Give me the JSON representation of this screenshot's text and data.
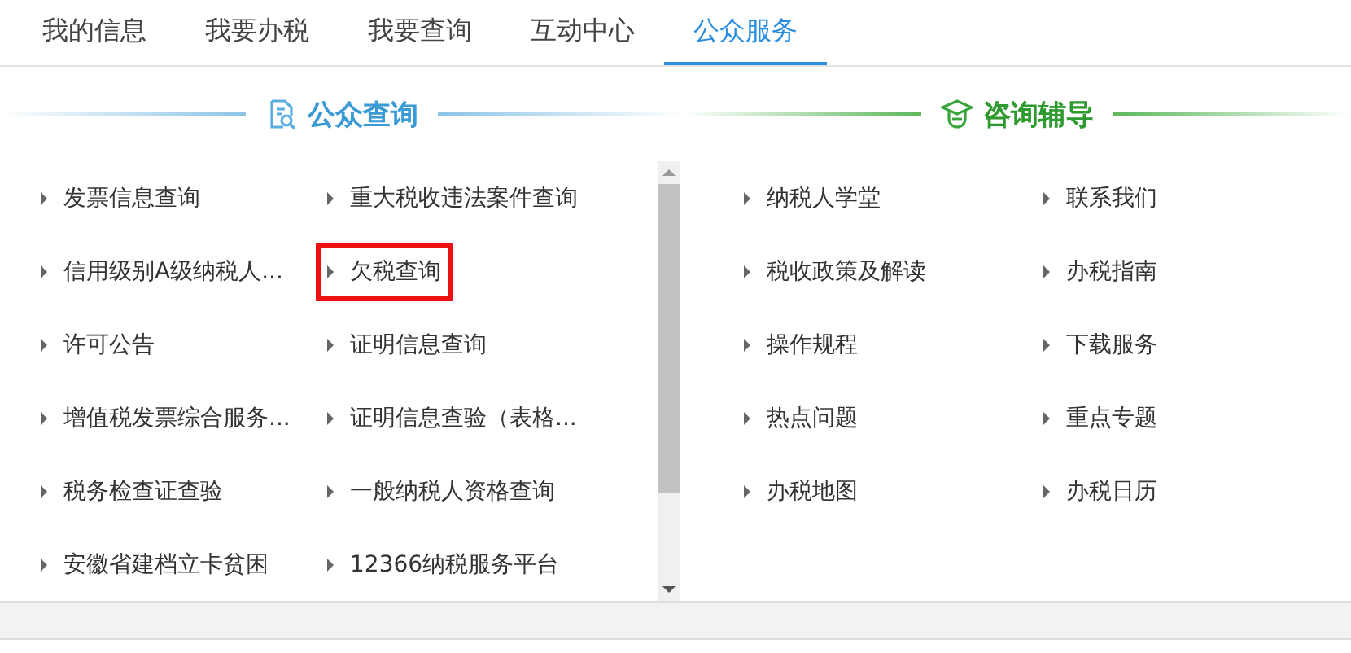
{
  "tabs": [
    {
      "label": "我的信息",
      "selected": false
    },
    {
      "label": "我要办税",
      "selected": false
    },
    {
      "label": "我要查询",
      "selected": false
    },
    {
      "label": "互动中心",
      "selected": false
    },
    {
      "label": "公众服务",
      "selected": true
    }
  ],
  "public_query": {
    "title": "公众查询",
    "items": [
      {
        "label": "发票信息查询",
        "highlighted": false
      },
      {
        "label": "重大税收违法案件查询",
        "highlighted": false
      },
      {
        "label": "信用级别A级纳税人...",
        "highlighted": false
      },
      {
        "label": "欠税查询",
        "highlighted": true
      },
      {
        "label": "许可公告",
        "highlighted": false
      },
      {
        "label": "证明信息查询",
        "highlighted": false
      },
      {
        "label": "增值税发票综合服务...",
        "highlighted": false
      },
      {
        "label": "证明信息查验（表格...",
        "highlighted": false
      },
      {
        "label": "税务检查证查验",
        "highlighted": false
      },
      {
        "label": "一般纳税人资格查询",
        "highlighted": false
      },
      {
        "label": "安徽省建档立卡贫困",
        "highlighted": false
      },
      {
        "label": "12366纳税服务平台",
        "highlighted": false
      }
    ]
  },
  "consulting": {
    "title": "咨询辅导",
    "items": [
      {
        "label": "纳税人学堂",
        "highlighted": false
      },
      {
        "label": "联系我们",
        "highlighted": false
      },
      {
        "label": "税收政策及解读",
        "highlighted": false
      },
      {
        "label": "办税指南",
        "highlighted": false
      },
      {
        "label": "操作规程",
        "highlighted": false
      },
      {
        "label": "下载服务",
        "highlighted": false
      },
      {
        "label": "热点问题",
        "highlighted": false
      },
      {
        "label": "重点专题",
        "highlighted": false
      },
      {
        "label": "办税地图",
        "highlighted": false
      },
      {
        "label": "办税日历",
        "highlighted": false
      }
    ]
  }
}
